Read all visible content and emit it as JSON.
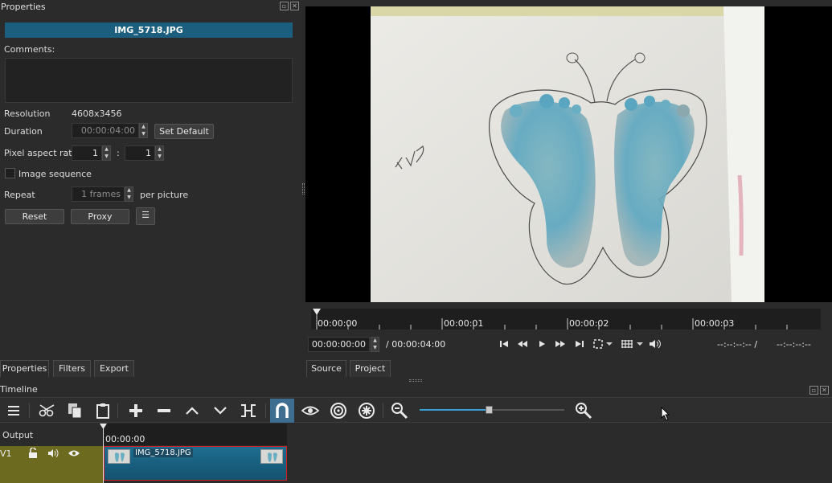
{
  "properties_panel": {
    "title": "Properties",
    "clip_name": "IMG_5718.JPG",
    "comments_label": "Comments:",
    "resolution_label": "Resolution",
    "resolution_value": "4608x3456",
    "duration_label": "Duration",
    "duration_value": "00:00:04:00",
    "set_default_label": "Set Default",
    "par_label": "Pixel aspect ratio",
    "par_num": "1",
    "par_sep": ":",
    "par_den": "1",
    "image_sequence_label": "Image sequence",
    "image_sequence_checked": false,
    "repeat_label": "Repeat",
    "repeat_value": "1 frames",
    "per_picture_label": "per picture",
    "reset_label": "Reset",
    "proxy_label": "Proxy",
    "tabs": [
      "Properties",
      "Filters",
      "Export"
    ]
  },
  "player": {
    "ruler_labels": [
      "00:00:00",
      "00:00:01",
      "00:00:02",
      "00:00:03"
    ],
    "position": "00:00:00:00",
    "duration": "/ 00:00:04:00",
    "in_point": "--:--:--:-- /",
    "out_point": "--:--:--:--",
    "tabs": [
      "Source",
      "Project"
    ],
    "icons": [
      "skip-previous-icon",
      "rewind-icon",
      "play-icon",
      "fast-forward-icon",
      "skip-next-icon",
      "zoom-fit-icon",
      "grid-icon",
      "volume-icon"
    ]
  },
  "timeline": {
    "title": "Timeline",
    "output_label": "Output",
    "track_name": "V1",
    "ruler_time": "00:00:00",
    "clip_label": "IMG_5718.JPG",
    "zoom_level": 0.48,
    "tools": [
      "menu-icon",
      "cut-icon",
      "copy-icon",
      "paste-icon",
      "append-icon",
      "remove-icon",
      "lift-icon",
      "overwrite-icon",
      "split-icon",
      "snap-icon",
      "scrub-icon",
      "ripple-icon",
      "ripple-all-icon",
      "zoom-out-icon",
      "zoom-in-icon"
    ]
  },
  "colors": {
    "accent": "#1b5e7e",
    "track_header": "#6b6a1f",
    "clip_border": "#d42020",
    "snap_active": "#3d6d8f"
  }
}
